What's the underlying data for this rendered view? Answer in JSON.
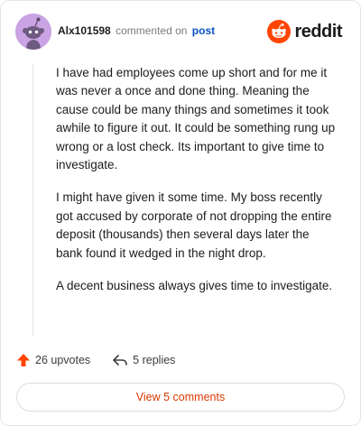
{
  "header": {
    "username": "Alx101598",
    "action_text": "commented on",
    "post_link": "post",
    "brand": "reddit"
  },
  "colors": {
    "brand_orange": "#ff4500",
    "link_blue": "#0a4fc4",
    "button_text": "#d93a00",
    "avatar_bg": "#c9a3e3"
  },
  "comment": {
    "paragraphs": [
      "I have had employees come up short and for me it was never a once and done thing. Meaning the cause could be many things and sometimes it took awhile to figure it out. It could be something rung up wrong or a lost check. Its important to give time to investigate.",
      "I might have given it some time. My boss recently got accused by corporate of not dropping the entire deposit (thousands) then several days later the bank found it wedged in the night drop.",
      "A decent business always gives time to investigate."
    ]
  },
  "actions": {
    "upvotes": "26 upvotes",
    "replies": "5 replies"
  },
  "footer": {
    "view_comments": "View 5 comments"
  },
  "icons": {
    "avatar": "snoo-avatar-icon",
    "logo": "reddit-snoo-icon",
    "upvote": "upvote-arrow-icon",
    "reply": "reply-arrow-icon"
  }
}
